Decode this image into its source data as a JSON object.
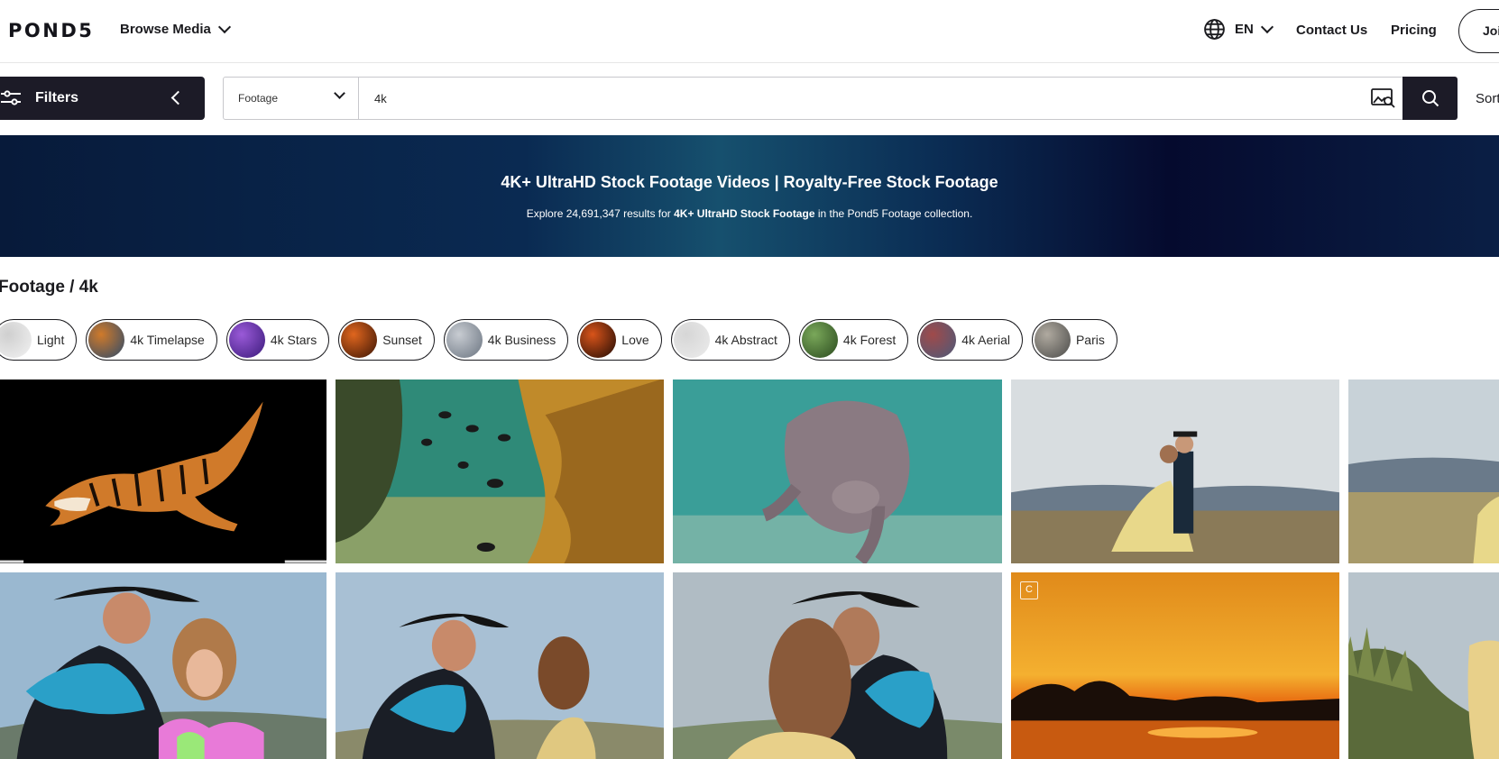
{
  "header": {
    "logo": "POND5",
    "browse_label": "Browse Media",
    "language": "EN",
    "contact_label": "Contact Us",
    "pricing_label": "Pricing",
    "join_label": "Join"
  },
  "search": {
    "filters_label": "Filters",
    "category": "Footage",
    "query": "4k",
    "sort_label": "Sort"
  },
  "banner": {
    "title": "4K+ UltraHD Stock Footage Videos | Royalty-Free Stock Footage",
    "sub_prefix": "Explore 24,691,347 results for ",
    "sub_bold": "4K+ UltraHD Stock Footage",
    "sub_suffix": " in the Pond5 Footage collection."
  },
  "breadcrumb": "Footage / 4k",
  "chips": [
    {
      "label": "Light",
      "colors": [
        "#f2f2f2",
        "#cfcfcf"
      ]
    },
    {
      "label": "4k Timelapse",
      "colors": [
        "#2c4a6b",
        "#d07a2a"
      ]
    },
    {
      "label": "4k Stars",
      "colors": [
        "#3a1a7a",
        "#9a5ad8"
      ]
    },
    {
      "label": "Sunset",
      "colors": [
        "#3a1405",
        "#e0661e"
      ]
    },
    {
      "label": "4k Business",
      "colors": [
        "#6a7480",
        "#c8ccd2"
      ]
    },
    {
      "label": "Love",
      "colors": [
        "#1e0a04",
        "#d8541a"
      ]
    },
    {
      "label": "4k Abstract",
      "colors": [
        "#ececec",
        "#d6d6d6"
      ]
    },
    {
      "label": "4k Forest",
      "colors": [
        "#2a4a1e",
        "#7aa85a"
      ]
    },
    {
      "label": "4k Aerial",
      "colors": [
        "#4a5a7a",
        "#a04a4a"
      ]
    },
    {
      "label": "Paris",
      "colors": [
        "#4a4a48",
        "#b0aaa0"
      ]
    }
  ],
  "grid": {
    "tiles": [
      {
        "name": "tiger-clip",
        "scene": "tiger"
      },
      {
        "name": "reef-fish-clip",
        "scene": "reef"
      },
      {
        "name": "manatee-clip",
        "scene": "manatee"
      },
      {
        "name": "couple-hillside-clip",
        "scene": "couple-field"
      },
      {
        "name": "hillside-partial-clip",
        "scene": "hill-partial"
      },
      {
        "name": "cowboy-couple-closeup-clip",
        "scene": "cowboy1"
      },
      {
        "name": "cowboy-couple-wind-clip",
        "scene": "cowboy2"
      },
      {
        "name": "cowboy-couple-kiss-clip",
        "scene": "cowboy3"
      },
      {
        "name": "orange-sunset-clip",
        "scene": "sunset",
        "badge": "C"
      },
      {
        "name": "grass-hill-partial-clip",
        "scene": "grass-partial"
      }
    ]
  }
}
